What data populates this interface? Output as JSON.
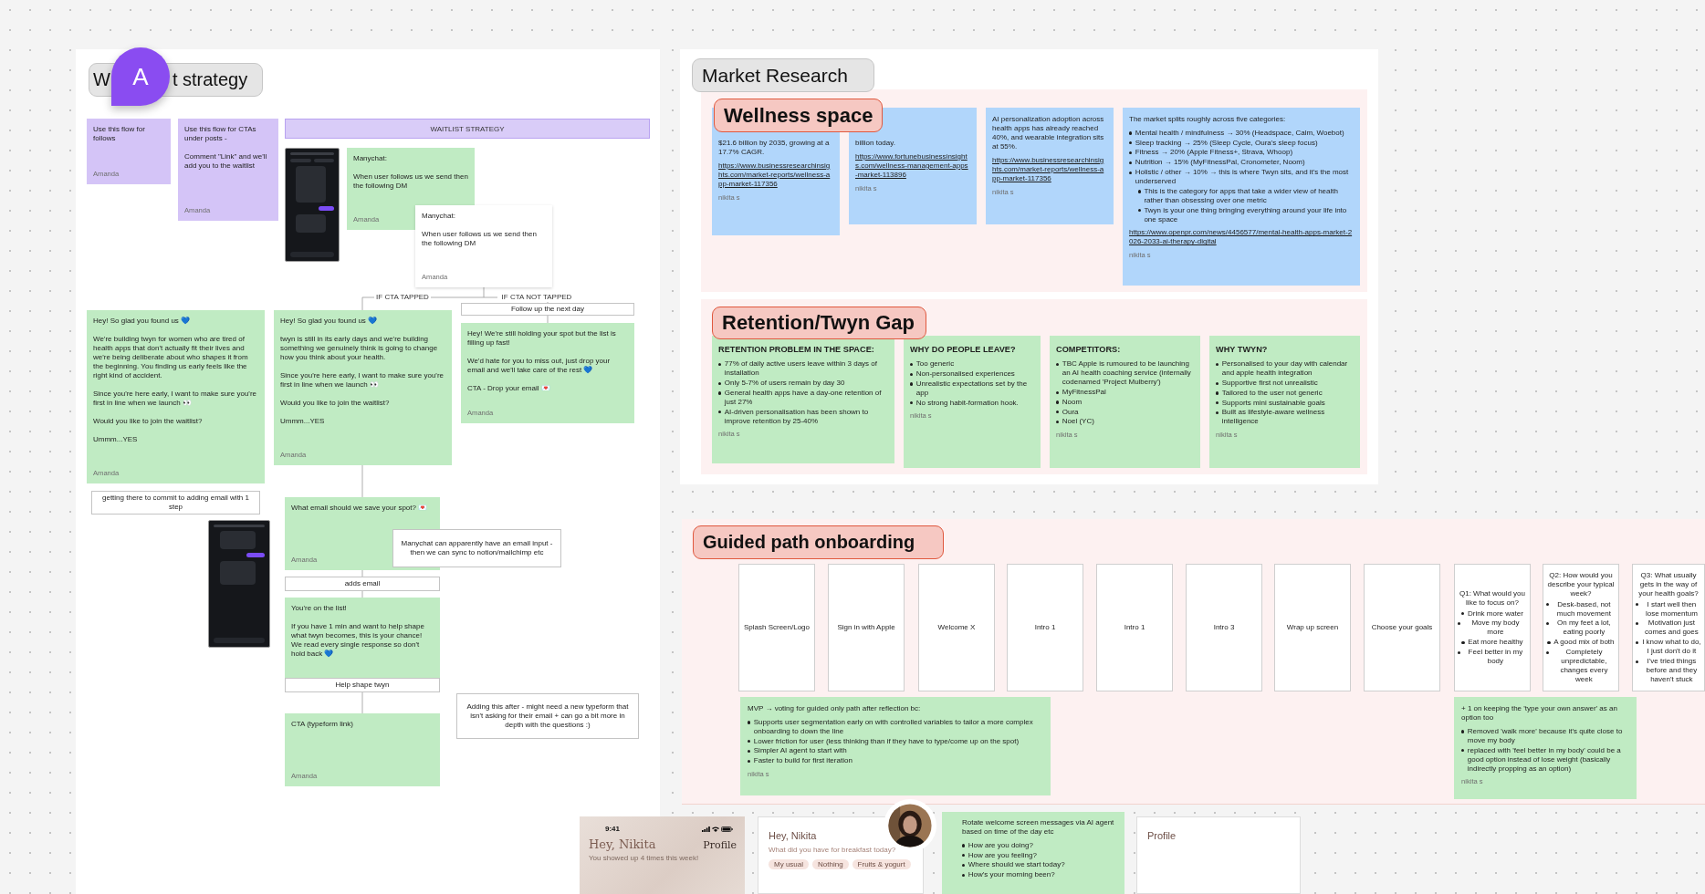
{
  "waitlist": {
    "title_parts": [
      "W",
      "t strategy"
    ],
    "avatar_initial": "A",
    "banner": "WAITLIST STRATEGY",
    "stickies": [
      {
        "color": "#d4c4f7",
        "text": "Use this flow for follows",
        "author": "Amanda"
      },
      {
        "color": "#d4c4f7",
        "text": "Use this flow for CTAs under posts -\n\nComment \"Link\" and we'll add you to the waitlist",
        "author": "Amanda"
      },
      {
        "color": "#c0ebc3",
        "text": "Manychat:\n\nWhen user follows us we send then the following DM",
        "author": "Amanda"
      },
      {
        "color": "#ffffff",
        "text": "Manychat:\n\nWhen user follows us we send then the following DM",
        "author": "Amanda"
      },
      {
        "color": "#c0ebc3",
        "text": "Hey! So glad you found us 💙\n\nWe're building twyn for women who are tired of health apps that don't actually fit their lives and we're being deliberate about who shapes it from the beginning. You finding us early feels like the right kind of accident.\n\nSince you're here early, I want to make sure you're first in line when we launch 👀\n\nWould you like to join the waitlist?\n\nUmmm...YES",
        "author": "Amanda"
      },
      {
        "color": "#c0ebc3",
        "text": "Hey! So glad you found us 💙\n\ntwyn is still in its early days and we're building something we genuinely think is going to change how you think about your health.\n\nSince you're here early, I want to make sure you're first in line when we launch 👀\n\nWould you like to join the waitlist?\n\nUmmm...YES",
        "author": "Amanda"
      },
      {
        "color": "#c0ebc3",
        "text": "Hey! We're still holding your spot but the list is filling up fast!\n\nWe'd hate for you to miss out, just drop your email and we'll take care of the rest 💙\n\nCTA - Drop your email 💌",
        "author": "Amanda"
      },
      {
        "color": "#c0ebc3",
        "text": "What email should we save your spot? 💌",
        "author": "Amanda"
      },
      {
        "color": "#c0ebc3",
        "text": "You're on the list!\n\nIf you have 1 min and want to help shape what twyn becomes, this is your chance! We read every single response so don't hold back 💙"
      },
      {
        "color": "#c0ebc3",
        "text": "CTA (typeform link)",
        "author": "Amanda"
      }
    ],
    "branch_labels": [
      "IF CTA TAPPED",
      "IF CTA NOT TAPPED"
    ],
    "boxes": [
      {
        "text": "Follow up the next day"
      },
      {
        "text": "getting there to commit to adding email with 1 step"
      },
      {
        "text": "Manychat can apparently have an email input - then we can sync to notion/mailchimp etc"
      },
      {
        "text": "adds email"
      },
      {
        "text": "Help shape twyn"
      },
      {
        "text": "Adding this after - might need a new typeform that isn't asking for their email + can go a bit more in depth with the questions :)"
      }
    ]
  },
  "market_research": {
    "title": "Market Research",
    "sections": [
      {
        "label": "Wellness space",
        "notes": [
          {
            "text": "$21.6 billion by 2035, growing at a 17.7% CAGR.",
            "link": "https://www.businessresearchinsights.com/market-reports/wellness-app-market-117356",
            "author": "nikita s"
          },
          {
            "text": "billion today.",
            "link": "https://www.fortunebusinessinsights.com/wellness-management-apps-market-113896",
            "author": "nikita s"
          },
          {
            "text": "AI personalization adoption across health apps has already reached 40%, and wearable integration sits at 55%.",
            "link": "https://www.businessresearchinsights.com/market-reports/wellness-app-market-117356",
            "author": "nikita s"
          },
          {
            "text": "The market splits roughly across five categories:",
            "bullets": [
              {
                "text": "Mental health / mindfulness → 30% (Headspace, Calm, Woebot)"
              },
              {
                "text": "Sleep tracking → 25% (Sleep Cycle, Oura's sleep focus)"
              },
              {
                "text": "Fitness → 20% (Apple Fitness+, Strava, Whoop)"
              },
              {
                "text": "Nutrition → 15% (MyFitnessPal, Cronometer, Noom)"
              },
              {
                "text": "Holistic / other → 10% → this is where Twyn sits, and it's the most underserved",
                "children": [
                  {
                    "text": "This is the category for apps that take a wider view of health rather than obsessing over one metric"
                  },
                  {
                    "text": "Twyn is your one thing bringing everything around your life into one space"
                  }
                ]
              }
            ],
            "link": "https://www.openpr.com/news/4456577/mental-health-apps-market-2026-2033-ai-therapy-digital",
            "author": "nikita s"
          }
        ]
      },
      {
        "label": "Retention/Twyn Gap",
        "notes": [
          {
            "heading": "RETENTION PROBLEM IN THE SPACE:",
            "bullets": [
              {
                "text": "77% of daily active users leave within 3 days of installation"
              },
              {
                "text": "Only 5-7% of users remain by day 30"
              },
              {
                "text": "General health apps have a day-one retention of just 27%"
              },
              {
                "text": "AI-driven personalisation has been shown to improve retention by 25-40%"
              }
            ],
            "author": "nikita s"
          },
          {
            "heading": "WHY DO PEOPLE LEAVE?",
            "bullets": [
              {
                "text": "Too generic"
              },
              {
                "text": "Non-personalised experiences"
              },
              {
                "text": "Unrealistic expectations set by the app"
              },
              {
                "text": "No strong habit-formation hook."
              }
            ],
            "author": "nikita s"
          },
          {
            "heading": "COMPETITORS:",
            "bullets": [
              {
                "text": "TBC Apple is rumoured to be launching an AI health coaching service (internally codenamed 'Project Mulberry')"
              },
              {
                "text": "MyFitnessPal"
              },
              {
                "text": "Noom"
              },
              {
                "text": "Oura"
              },
              {
                "text": "Noel (YC)"
              }
            ],
            "author": "nikita s"
          },
          {
            "heading": "WHY TWYN?",
            "bullets": [
              {
                "text": "Personalised to your day with calendar and apple health integration"
              },
              {
                "text": "Supportive first not unrealistic"
              },
              {
                "text": "Tailored to the user not generic"
              },
              {
                "text": "Supports mini sustainable goals"
              },
              {
                "text": "Built as lifestyle-aware wellness intelligence"
              }
            ],
            "author": "nikita s"
          }
        ]
      }
    ]
  },
  "guided_path": {
    "label": "Guided path onboarding",
    "screens": [
      {
        "kind": "screen",
        "title": "Splash Screen/Logo"
      },
      {
        "kind": "screen",
        "title": "Sign in with Apple"
      },
      {
        "kind": "screen",
        "title": "Welcome X"
      },
      {
        "kind": "screen",
        "title": "Intro 1"
      },
      {
        "kind": "screen",
        "title": "Intro 1"
      },
      {
        "kind": "screen",
        "title": "Intro 3"
      },
      {
        "kind": "screen",
        "title": "Wrap up screen"
      },
      {
        "kind": "screen",
        "title": "Choose your goals"
      },
      {
        "kind": "question",
        "title": "Q1: What would you like to focus on?",
        "options": [
          {
            "text": "Drink more water"
          },
          {
            "text": "Move my body more"
          },
          {
            "text": "Eat more healthy"
          },
          {
            "text": "Feel better in my body"
          }
        ]
      },
      {
        "kind": "question",
        "title": "Q2: How would you describe your typical week?",
        "options": [
          {
            "text": "Desk-based, not much movement"
          },
          {
            "text": "On my feet a lot, eating poorly"
          },
          {
            "text": "A good mix of both"
          },
          {
            "text": "Completely unpredictable, changes every week"
          }
        ]
      },
      {
        "kind": "question",
        "title": "Q3: What usually gets in the way of your health goals?",
        "options": [
          {
            "text": "I start well then lose momentum"
          },
          {
            "text": "Motivation just comes and goes"
          },
          {
            "text": "I know what to do, I just don't do it"
          },
          {
            "text": "I've tried things before and they haven't stuck"
          }
        ]
      }
    ],
    "notes": [
      {
        "text": "MVP → voting for guided only path after reflection bc:",
        "bullets": [
          {
            "text": "Supports user segmentation early on with controlled variables to tailor a more complex onboarding to down the line"
          },
          {
            "text": "Lower friction for user (less thinking than if they have to type/come up on the spot)"
          },
          {
            "text": "Simpler AI agent to start with"
          },
          {
            "text": "Faster to build for first iteration"
          }
        ],
        "author": "nikita s"
      },
      {
        "text": "+ 1 on keeping the 'type your own answer' as an option too",
        "bullets": [
          {
            "text": "Removed 'walk more' because it's quite close to move my body"
          },
          {
            "text": "replaced with 'feel better in my body' could be a good option instead of lose weight (basically indirectly propping as an option)"
          }
        ],
        "author": "nikita s"
      }
    ]
  },
  "mockups": {
    "phone": {
      "time": "9:41",
      "greeting": "Hey, Nikita",
      "profile_link": "Profile",
      "subtitle": "You showed up 4 times this week!"
    },
    "home_card": {
      "greeting": "Hey, Nikita",
      "prompt": "What did you have for breakfast today?",
      "chips": [
        "My usual",
        "Nothing",
        "Fruits & yogurt"
      ]
    },
    "note": {
      "text": "Rotate welcome screen messages via AI agent based on time of the day etc",
      "bullets": [
        {
          "text": "How are you doing?"
        },
        {
          "text": "How are you feeling?"
        },
        {
          "text": "Where should we start today?"
        },
        {
          "text": "How's your morning been?"
        }
      ]
    },
    "profile_card": {
      "title": "Profile"
    }
  }
}
